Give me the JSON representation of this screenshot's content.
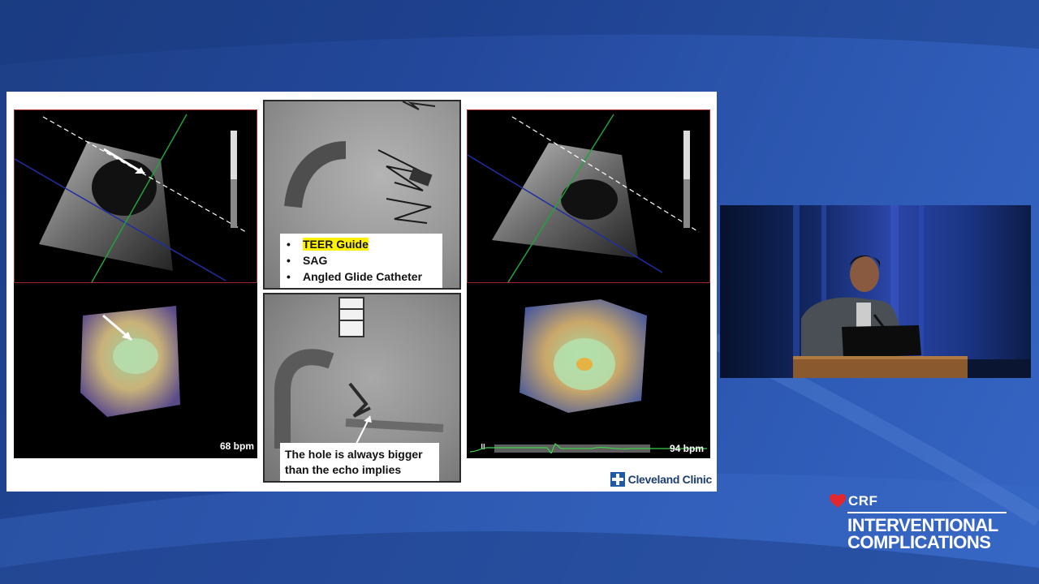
{
  "slide": {
    "callout_top": {
      "items": [
        {
          "label": "TEER Guide",
          "highlighted": true
        },
        {
          "label": "SAG",
          "highlighted": false
        },
        {
          "label": "Angled Glide Catheter",
          "highlighted": false
        }
      ]
    },
    "callout_bottom": {
      "line1": "The hole is always bigger",
      "line2": "than the echo implies"
    },
    "left_echo": {
      "heart_rate": "68 bpm"
    },
    "right_echo": {
      "heart_rate": "94 bpm"
    },
    "logo": {
      "text": "Cleveland Clinic",
      "icon": "cleveland-clinic-cross-icon"
    }
  },
  "branding": {
    "org": "CRF",
    "event_line1": "INTERVENTIONAL",
    "event_line2": "COMPLICATIONS",
    "icon": "heart-icon"
  },
  "colors": {
    "background": "#2a52a8",
    "highlight": "#fff200",
    "echo_border": "#a0262c",
    "ecg_trace": "#3fd24a"
  }
}
